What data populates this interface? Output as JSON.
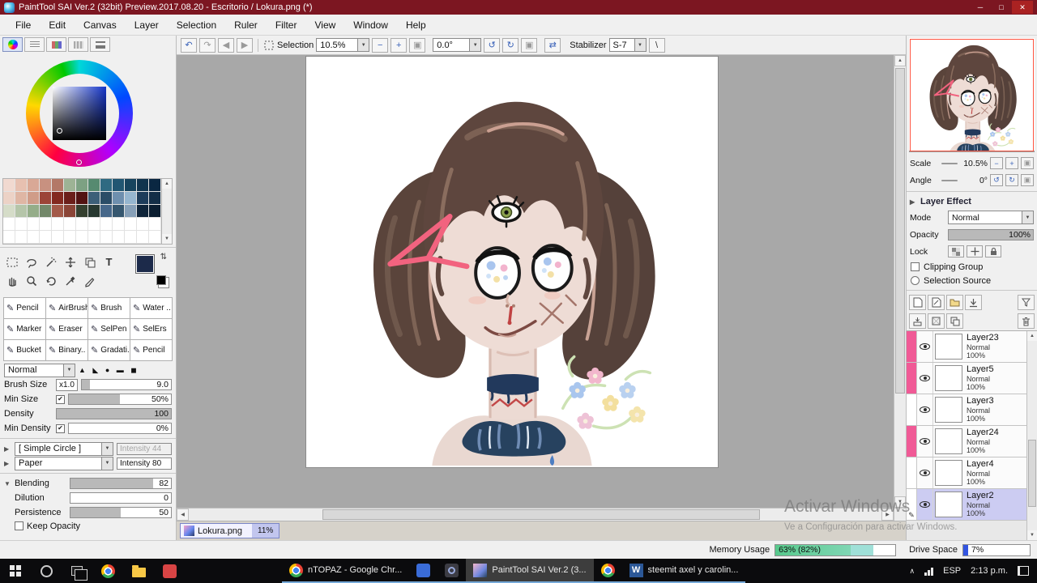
{
  "window": {
    "title": "PaintTool SAI Ver.2 (32bit) Preview.2017.08.20 - Escritorio / Lokura.png (*)"
  },
  "menu": {
    "items": [
      "File",
      "Edit",
      "Canvas",
      "Layer",
      "Selection",
      "Ruler",
      "Filter",
      "View",
      "Window",
      "Help"
    ]
  },
  "toolbar": {
    "selection_label": "Selection",
    "zoom": "10.5%",
    "angle": "0.0°",
    "stabilizer_label": "Stabilizer",
    "stabilizer": "S-7"
  },
  "tools": {
    "names": [
      "Pencil",
      "AirBrush",
      "Brush",
      "Water ..",
      "Marker",
      "Eraser",
      "SelPen",
      "SelErs",
      "Bucket",
      "Binary..",
      "Gradati..",
      "Pencil"
    ]
  },
  "brush": {
    "mode": "Normal",
    "size_label": "Brush Size",
    "size_mult": "x1.0",
    "size": "9.0",
    "min_size_label": "Min Size",
    "min_size": "50%",
    "density_label": "Density",
    "density": "100",
    "min_density_label": "Min Density",
    "min_density": "0%",
    "shape": "[ Simple Circle ]",
    "shape_intensity": "Intensity 44",
    "texture": "Paper",
    "texture_intensity": "Intensity 80",
    "blending_label": "Blending",
    "blending": "82",
    "dilution_label": "Dilution",
    "dilution": "0",
    "persistence_label": "Persistence",
    "persistence": "50",
    "keep_opacity": "Keep Opacity"
  },
  "navigator": {
    "scale_label": "Scale",
    "scale": "10.5%",
    "angle_label": "Angle",
    "angle": "0°"
  },
  "layer_panel": {
    "effect_label": "Layer Effect",
    "mode_label": "Mode",
    "mode": "Normal",
    "opacity_label": "Opacity",
    "opacity": "100%",
    "lock_label": "Lock",
    "clipping": "Clipping Group",
    "selection_source": "Selection Source",
    "layers": [
      {
        "name": "Layer23",
        "mode": "Normal",
        "opacity": "100%",
        "marked": true,
        "selected": false
      },
      {
        "name": "Layer5",
        "mode": "Normal",
        "opacity": "100%",
        "marked": true,
        "selected": false
      },
      {
        "name": "Layer3",
        "mode": "Normal",
        "opacity": "100%",
        "marked": false,
        "selected": false
      },
      {
        "name": "Layer24",
        "mode": "Normal",
        "opacity": "100%",
        "marked": true,
        "selected": false
      },
      {
        "name": "Layer4",
        "mode": "Normal",
        "opacity": "100%",
        "marked": false,
        "selected": false
      },
      {
        "name": "Layer2",
        "mode": "Normal",
        "opacity": "100%",
        "marked": false,
        "selected": true
      }
    ]
  },
  "doc_tab": {
    "name": "Lokura.png",
    "zoom": "11%"
  },
  "status": {
    "memory_label": "Memory Usage",
    "memory": "63% (82%)",
    "drive_label": "Drive Space",
    "drive": "7%"
  },
  "watermark": {
    "line1": "Activar Windows",
    "line2": "Ve a Configuración para activar Windows."
  },
  "taskbar": {
    "apps": [
      "nTOPAZ - Google Chr...",
      "PaintTool SAI Ver.2 (3...",
      "steemit axel y carolin..."
    ],
    "lang": "ESP",
    "time": "2:13 p.m."
  },
  "colors": {
    "accent_pink": "#f05a96",
    "titlebar": "#7c1621",
    "selected_layer": "#ccccf2",
    "foreground_color": "#1c2a4a"
  },
  "icons": {
    "min": "─",
    "max": "□",
    "close": "✕",
    "undo": "↶",
    "redo": "↷",
    "minus": "−",
    "plus": "+",
    "rotate_ccw": "↺",
    "rotate_cw": "↻",
    "swap": "⇄",
    "backslash": "\\",
    "combo": "▼",
    "right": "▶",
    "down": "▼",
    "up": "▲",
    "left": "◀",
    "check": "✔",
    "pen": "✎",
    "text": "T",
    "chevron_up": "∧",
    "brush_tips": "▲ ◣ ● ▬ ◼",
    "word": "W",
    "swap_small": "⇅",
    "reset": "▣"
  },
  "swatches": [
    "#f1d9d0",
    "#e7c0b0",
    "#d9a896",
    "#c89180",
    "#b37867",
    "#9db395",
    "#7da183",
    "#568a70",
    "#2f6a82",
    "#215672",
    "#17445e",
    "#10344e",
    "#0a2742",
    "#ecd2c6",
    "#dfb6a4",
    "#d09c88",
    "#9c4438",
    "#83291f",
    "#6b1f1a",
    "#521312",
    "#3c5f78",
    "#2b4d67",
    "#6e8fae",
    "#96b6cf",
    "#1d3c5a",
    "#132e47",
    "#d5dcc8",
    "#b5c5a9",
    "#95ad89",
    "#73886a",
    "#a35a49",
    "#8b4537",
    "#35402f",
    "#273830",
    "#47688a",
    "#36576f",
    "#87a0b8",
    "#0f2439",
    "#0b1e31"
  ]
}
